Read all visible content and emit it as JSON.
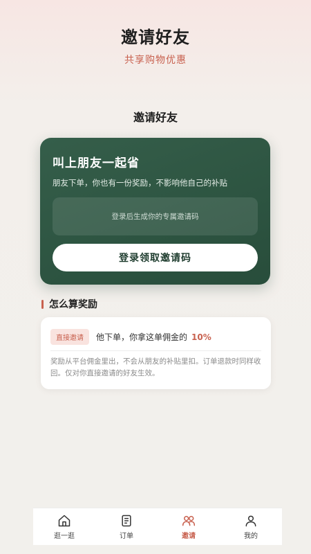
{
  "header": {
    "title": "邀请好友",
    "subtitle": "共享购物优惠"
  },
  "section": {
    "title": "邀请好友"
  },
  "invite_card": {
    "heading": "叫上朋友一起省",
    "description": "朋友下单，你也有一份奖励，不影响他自己的补贴",
    "code_placeholder": "登录后生成你的专属邀请码",
    "login_button": "登录领取邀请码"
  },
  "reward": {
    "title": "怎么算奖励",
    "tag": "直接邀请",
    "text": "他下单，你拿这单佣金的",
    "rate": "10%",
    "note": "奖励从平台佣金里出，不会从朋友的补贴里扣。订单退款时同样收回。仅对你直接邀请的好友生效。"
  },
  "tabbar": {
    "items": [
      {
        "label": "逛一逛",
        "icon": "home-icon",
        "active": false
      },
      {
        "label": "订单",
        "icon": "order-icon",
        "active": false
      },
      {
        "label": "邀请",
        "icon": "invite-icon",
        "active": true
      },
      {
        "label": "我的",
        "icon": "user-icon",
        "active": false
      }
    ]
  },
  "colors": {
    "accent": "#c8614f",
    "card_green": "#2d5441"
  }
}
